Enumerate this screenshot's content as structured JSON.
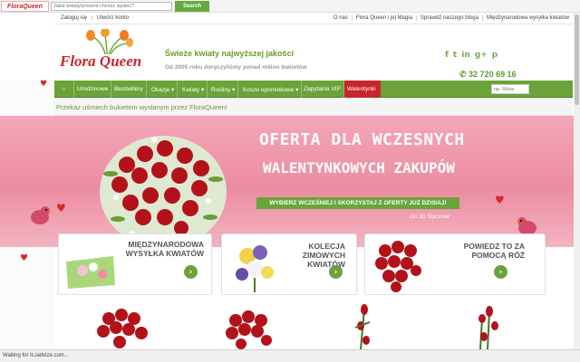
{
  "extension": {
    "logo": "FloraQueen",
    "search_placeholder": "Jakie kwiaty/prezent chcesz wysłać?",
    "search_button": "Search"
  },
  "header": {
    "login": "Zaloguj się",
    "create_account": "Utwórz konto",
    "links_right": [
      "O nas",
      "Flora Queen i jej Magia",
      "Sprawdź naszego bloga",
      "Międzynarodowa wysyłka kwiatów"
    ],
    "logo_text": "Flora Queen",
    "tagline": "Świeże kwiaty najwyższej jakości",
    "subtag": "Od 2005 roku doręczyliśmy ponad milion bukietów",
    "phone": "32 720 69 16",
    "socials": [
      "f",
      "t",
      "in",
      "g+",
      "p"
    ]
  },
  "nav": {
    "items": [
      "Urodzinowe",
      "Bestsellery",
      "Okazje ▾",
      "Kwiaty ▾",
      "Rośliny ▾",
      "Kosze upominkowe ▾",
      "Zapytania VIP",
      "Walentynki"
    ],
    "search_placeholder": "np. Róża"
  },
  "promo": "Przekaz uśmiech bukietem wysłanym przez FloraQueen!",
  "hero": {
    "title1": "OFERTA DLA WCZESNYCH",
    "title2": "WALENTYNKOWYCH ZAKUPÓW",
    "ribbon": "WYBIERZ WCZEŚNIEJ I SKORZYSTAJ Z OFERTY JUŻ DZISIAJ!",
    "date": "Do 30 Stycznia"
  },
  "tiles": [
    {
      "label": "MIĘDZYNARODOWA WYSYŁKA KWIATÓW"
    },
    {
      "label": "KOLECJA ZIMOWYCH KWIATÓW"
    },
    {
      "label": "POWIEDZ TO ZA POMOCĄ RÓŻ"
    }
  ],
  "status": "Waiting for lc.iadvize.com...",
  "colors": {
    "brand_green": "#6ba33a",
    "brand_red": "#c8262c",
    "hero_pink": "#ec8ca1"
  }
}
